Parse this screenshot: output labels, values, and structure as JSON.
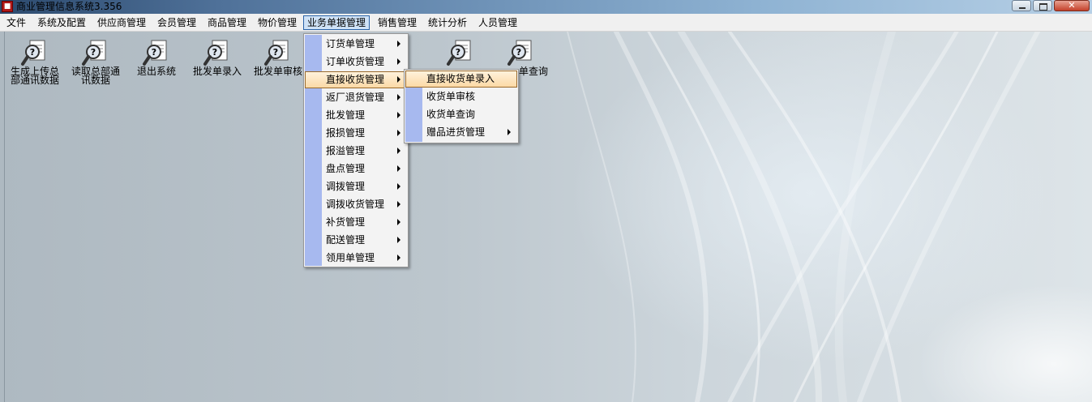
{
  "window": {
    "title": "商业管理信息系统3.356",
    "app_icon_name": "app-book-icon",
    "controls": [
      "minimize-icon",
      "maximize-icon",
      "close-icon"
    ]
  },
  "menubar": {
    "items": [
      "文件",
      "系统及配置",
      "供应商管理",
      "会员管理",
      "商品管理",
      "物价管理",
      "业务单据管理",
      "销售管理",
      "统计分析",
      "人员管理"
    ],
    "active_index": 6
  },
  "toolbar": {
    "icon_name": "search-document-icon",
    "items": [
      {
        "line1": "生成上传总",
        "line2": "部通讯数据"
      },
      {
        "line1": "读取总部通",
        "line2": "讯数据"
      },
      {
        "line1": "退出系统",
        "line2": ""
      },
      {
        "line1": "批发单录入",
        "line2": ""
      },
      {
        "line1": "批发单审核",
        "line2": ""
      },
      {
        "line1": "",
        "line2": ""
      },
      {
        "line1": "",
        "line2": ""
      },
      {
        "line1": "单查询",
        "line2": ""
      }
    ]
  },
  "business_menu": {
    "items": [
      "订货单管理",
      "订单收货管理",
      "直接收货管理",
      "返厂退货管理",
      "批发管理",
      "报损管理",
      "报溢管理",
      "盘点管理",
      "调拨管理",
      "调拨收货管理",
      "补货管理",
      "配送管理",
      "领用单管理"
    ],
    "highlighted_index": 2,
    "gutter_color": "#a7b9ef"
  },
  "direct_receive_submenu": {
    "items": [
      "直接收货单录入",
      "收货单审核",
      "收货单查询",
      "赠品进货管理"
    ],
    "highlighted_index": 0
  },
  "colors": {
    "menu_highlight_border": "#9a6a2c",
    "menubar_active_border": "#2a63a8"
  }
}
